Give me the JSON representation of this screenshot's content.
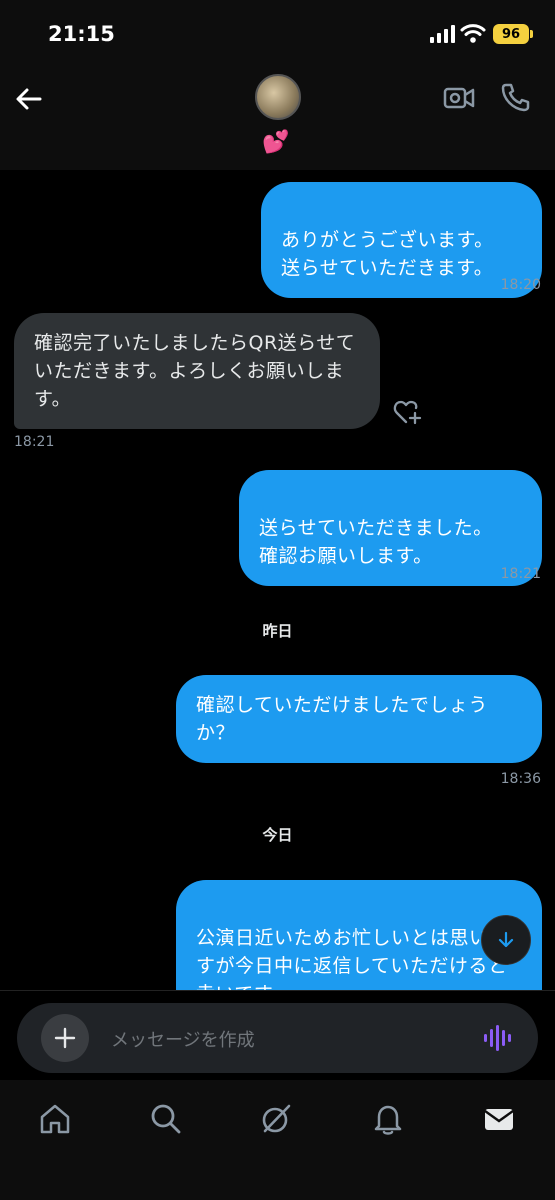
{
  "status": {
    "time": "21:15",
    "battery": "96"
  },
  "header": {
    "contact_badge": "💕"
  },
  "messages": [
    {
      "dir": "out",
      "text": "ありがとうございます。\n送らせていただきます。",
      "time": "18:20"
    },
    {
      "dir": "in",
      "text": "確認完了いたしましたらQR送らせていただきます。よろしくお願いします。",
      "time": "18:21"
    },
    {
      "dir": "out",
      "text": "送らせていただきました。\n確認お願いします。",
      "time": "18:21"
    },
    {
      "dir": "sep",
      "text": "昨日"
    },
    {
      "dir": "out",
      "text": "確認していただけましたでしょうか？",
      "time": "18:36"
    },
    {
      "dir": "sep",
      "text": "今日"
    },
    {
      "dir": "out",
      "text": "公演日近いためお忙しいとは思いますが今日中に返信していただけると幸いです。\n母票チケットがない場合は返金お"
    }
  ],
  "composer": {
    "placeholder": "メッセージを作成"
  },
  "colors": {
    "outgoing": "#1d9bf0",
    "incoming": "#2f3336",
    "voice": "#8b5cf6"
  },
  "tabs": [
    "home-icon",
    "search-icon",
    "grok-icon",
    "notifications-icon",
    "messages-icon"
  ]
}
